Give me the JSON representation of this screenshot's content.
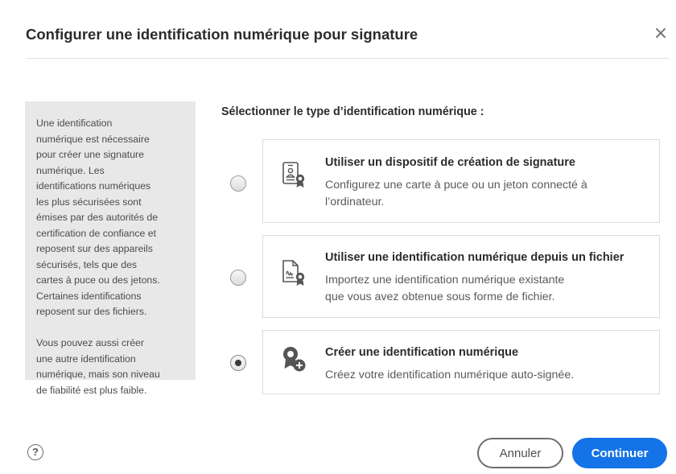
{
  "dialog": {
    "title": "Configurer une identification numérique pour signature",
    "close_icon": "close-icon",
    "close_glyph": "×"
  },
  "info_panel": {
    "text": "Une identification\nnumérique est nécessaire\npour créer une signature\nnumérique. Les\nidentifications numériques\nles plus sécurisées sont\némises par des autorités de\ncertification de confiance et\nreposent sur des appareils\nsécurisés, tels que des\ncartes à puce ou des jetons.\nCertaines identifications\nreposent sur des fichiers.\n\nVous pouvez aussi créer\nune autre identification\nnumérique, mais son niveau\nde fiabilité est plus faible."
  },
  "section": {
    "heading": "Sélectionner le type d’identification numérique :"
  },
  "options": [
    {
      "title": "Utiliser un dispositif de création de signature",
      "description": "Configurez une carte à puce ou un jeton connecté à\nl’ordinateur.",
      "icon": "signature-device-icon",
      "selected": false
    },
    {
      "title": "Utiliser une identification numérique depuis un fichier",
      "description": "Importez une identification numérique existante\nque vous avez obtenue sous forme de fichier.",
      "icon": "digital-id-file-icon",
      "selected": false
    },
    {
      "title": "Créer une identification numérique",
      "description": "Créez votre identification numérique auto-signée.",
      "icon": "create-digital-id-icon",
      "selected": true
    }
  ],
  "footer": {
    "help_glyph": "?",
    "cancel_label": "Annuler",
    "continue_label": "Continuer"
  },
  "colors": {
    "accent": "#1473e6",
    "panel_bg": "#e8e8e8",
    "card_border": "#dcdcdc"
  }
}
